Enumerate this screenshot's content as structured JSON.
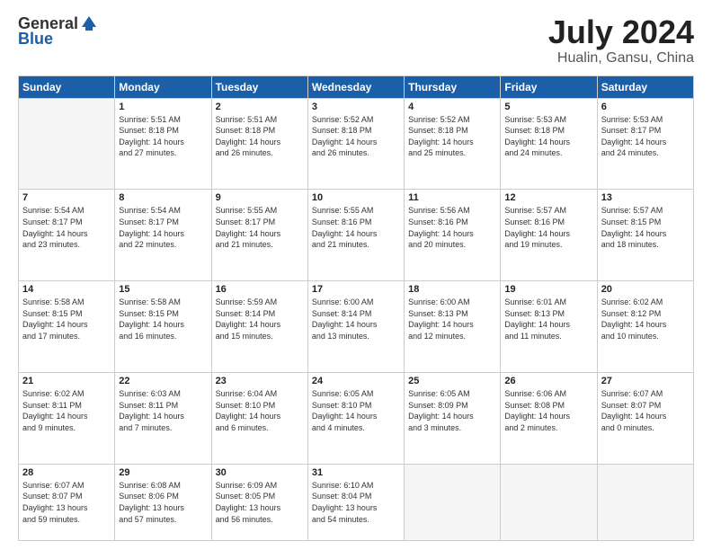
{
  "logo": {
    "general": "General",
    "blue": "Blue"
  },
  "title": "July 2024",
  "subtitle": "Hualin, Gansu, China",
  "headers": [
    "Sunday",
    "Monday",
    "Tuesday",
    "Wednesday",
    "Thursday",
    "Friday",
    "Saturday"
  ],
  "weeks": [
    [
      {
        "day": "",
        "info": ""
      },
      {
        "day": "1",
        "info": "Sunrise: 5:51 AM\nSunset: 8:18 PM\nDaylight: 14 hours\nand 27 minutes."
      },
      {
        "day": "2",
        "info": "Sunrise: 5:51 AM\nSunset: 8:18 PM\nDaylight: 14 hours\nand 26 minutes."
      },
      {
        "day": "3",
        "info": "Sunrise: 5:52 AM\nSunset: 8:18 PM\nDaylight: 14 hours\nand 26 minutes."
      },
      {
        "day": "4",
        "info": "Sunrise: 5:52 AM\nSunset: 8:18 PM\nDaylight: 14 hours\nand 25 minutes."
      },
      {
        "day": "5",
        "info": "Sunrise: 5:53 AM\nSunset: 8:18 PM\nDaylight: 14 hours\nand 24 minutes."
      },
      {
        "day": "6",
        "info": "Sunrise: 5:53 AM\nSunset: 8:17 PM\nDaylight: 14 hours\nand 24 minutes."
      }
    ],
    [
      {
        "day": "7",
        "info": "Sunrise: 5:54 AM\nSunset: 8:17 PM\nDaylight: 14 hours\nand 23 minutes."
      },
      {
        "day": "8",
        "info": "Sunrise: 5:54 AM\nSunset: 8:17 PM\nDaylight: 14 hours\nand 22 minutes."
      },
      {
        "day": "9",
        "info": "Sunrise: 5:55 AM\nSunset: 8:17 PM\nDaylight: 14 hours\nand 21 minutes."
      },
      {
        "day": "10",
        "info": "Sunrise: 5:55 AM\nSunset: 8:16 PM\nDaylight: 14 hours\nand 21 minutes."
      },
      {
        "day": "11",
        "info": "Sunrise: 5:56 AM\nSunset: 8:16 PM\nDaylight: 14 hours\nand 20 minutes."
      },
      {
        "day": "12",
        "info": "Sunrise: 5:57 AM\nSunset: 8:16 PM\nDaylight: 14 hours\nand 19 minutes."
      },
      {
        "day": "13",
        "info": "Sunrise: 5:57 AM\nSunset: 8:15 PM\nDaylight: 14 hours\nand 18 minutes."
      }
    ],
    [
      {
        "day": "14",
        "info": "Sunrise: 5:58 AM\nSunset: 8:15 PM\nDaylight: 14 hours\nand 17 minutes."
      },
      {
        "day": "15",
        "info": "Sunrise: 5:58 AM\nSunset: 8:15 PM\nDaylight: 14 hours\nand 16 minutes."
      },
      {
        "day": "16",
        "info": "Sunrise: 5:59 AM\nSunset: 8:14 PM\nDaylight: 14 hours\nand 15 minutes."
      },
      {
        "day": "17",
        "info": "Sunrise: 6:00 AM\nSunset: 8:14 PM\nDaylight: 14 hours\nand 13 minutes."
      },
      {
        "day": "18",
        "info": "Sunrise: 6:00 AM\nSunset: 8:13 PM\nDaylight: 14 hours\nand 12 minutes."
      },
      {
        "day": "19",
        "info": "Sunrise: 6:01 AM\nSunset: 8:13 PM\nDaylight: 14 hours\nand 11 minutes."
      },
      {
        "day": "20",
        "info": "Sunrise: 6:02 AM\nSunset: 8:12 PM\nDaylight: 14 hours\nand 10 minutes."
      }
    ],
    [
      {
        "day": "21",
        "info": "Sunrise: 6:02 AM\nSunset: 8:11 PM\nDaylight: 14 hours\nand 9 minutes."
      },
      {
        "day": "22",
        "info": "Sunrise: 6:03 AM\nSunset: 8:11 PM\nDaylight: 14 hours\nand 7 minutes."
      },
      {
        "day": "23",
        "info": "Sunrise: 6:04 AM\nSunset: 8:10 PM\nDaylight: 14 hours\nand 6 minutes."
      },
      {
        "day": "24",
        "info": "Sunrise: 6:05 AM\nSunset: 8:10 PM\nDaylight: 14 hours\nand 4 minutes."
      },
      {
        "day": "25",
        "info": "Sunrise: 6:05 AM\nSunset: 8:09 PM\nDaylight: 14 hours\nand 3 minutes."
      },
      {
        "day": "26",
        "info": "Sunrise: 6:06 AM\nSunset: 8:08 PM\nDaylight: 14 hours\nand 2 minutes."
      },
      {
        "day": "27",
        "info": "Sunrise: 6:07 AM\nSunset: 8:07 PM\nDaylight: 14 hours\nand 0 minutes."
      }
    ],
    [
      {
        "day": "28",
        "info": "Sunrise: 6:07 AM\nSunset: 8:07 PM\nDaylight: 13 hours\nand 59 minutes."
      },
      {
        "day": "29",
        "info": "Sunrise: 6:08 AM\nSunset: 8:06 PM\nDaylight: 13 hours\nand 57 minutes."
      },
      {
        "day": "30",
        "info": "Sunrise: 6:09 AM\nSunset: 8:05 PM\nDaylight: 13 hours\nand 56 minutes."
      },
      {
        "day": "31",
        "info": "Sunrise: 6:10 AM\nSunset: 8:04 PM\nDaylight: 13 hours\nand 54 minutes."
      },
      {
        "day": "",
        "info": ""
      },
      {
        "day": "",
        "info": ""
      },
      {
        "day": "",
        "info": ""
      }
    ]
  ]
}
